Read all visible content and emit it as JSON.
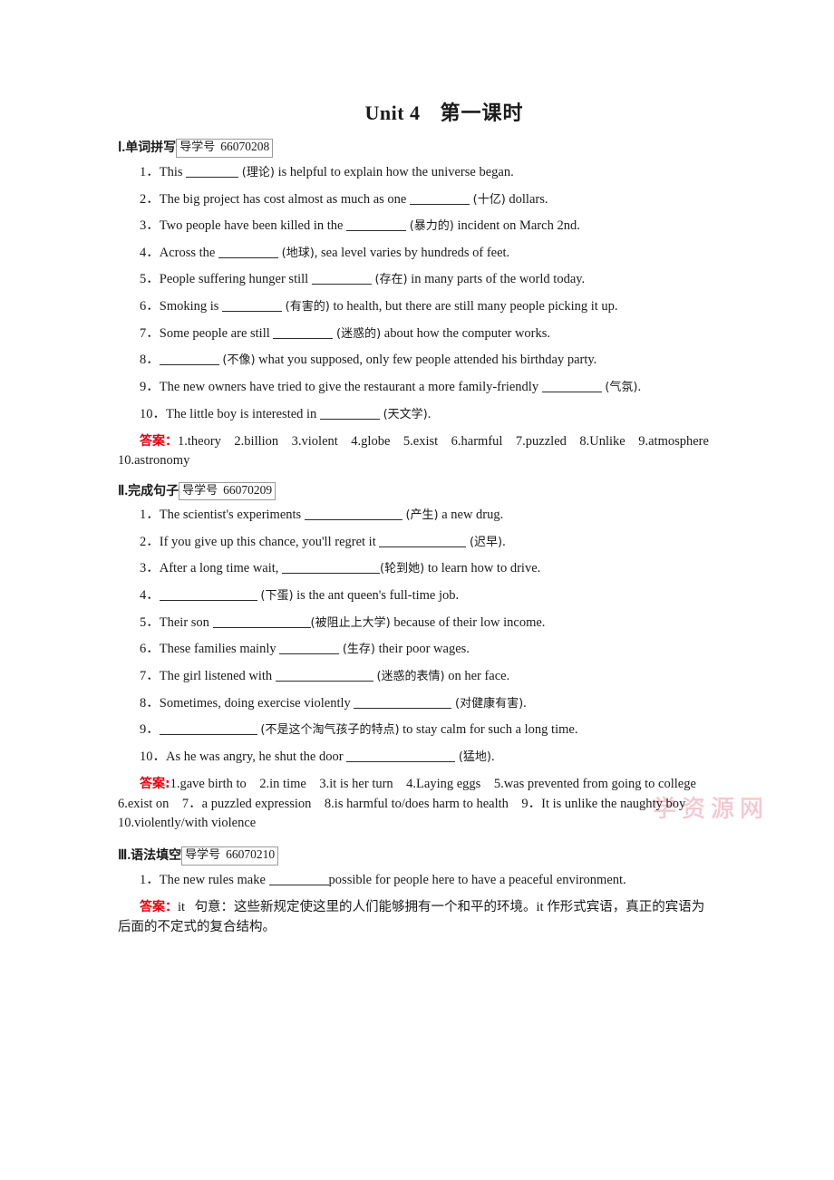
{
  "document": {
    "title_unit": "Unit 4",
    "title_cn": "第一课时",
    "watermark": "学资源网"
  },
  "sections": [
    {
      "numeral": "Ⅰ.",
      "name": "单词拼写",
      "badge_label": "导学号",
      "badge_number": "66070208",
      "questions": [
        {
          "num": "1．",
          "pre": "This ",
          "hint": "(理论)",
          "post": " is helpful to explain how the universe began.",
          "blank": "b-sm"
        },
        {
          "num": "2．",
          "pre": "The big project has cost almost as much as one ",
          "hint": "(十亿)",
          "post": " dollars.",
          "blank": "b-md"
        },
        {
          "num": "3．",
          "pre": "Two people have been killed in the ",
          "hint": "(暴力的)",
          "post": " incident on March 2nd.",
          "blank": "b-md"
        },
        {
          "num": "4．",
          "pre": "Across the ",
          "hint": "(地球)",
          "post": ", sea level varies by hundreds of feet.",
          "blank": "b-md"
        },
        {
          "num": "5．",
          "pre": "People suffering hunger still ",
          "hint": "(存在)",
          "post": " in many parts of the world today.",
          "blank": "b-md"
        },
        {
          "num": "6．",
          "pre": "Smoking is ",
          "hint": "(有害的)",
          "post": " to health, but there are still many people picking it up.",
          "blank": "b-md"
        },
        {
          "num": "7．",
          "pre": "Some people are still ",
          "hint": "(迷惑的)",
          "post": " about how the computer works.",
          "blank": "b-md"
        },
        {
          "num": "8．",
          "pre": "",
          "hint": "(不像)",
          "post": " what you supposed, only few people attended his birthday party.",
          "blank": "b-md"
        },
        {
          "num": "9．",
          "pre": "The new owners have tried to give the restaurant a more family-friendly ",
          "hint": "(气氛)",
          "post": ".",
          "blank": "b-md"
        },
        {
          "num": "10．",
          "pre": "The little boy is interested in ",
          "hint": "(天文学)",
          "post": ".",
          "blank": "b-md"
        }
      ],
      "answer_label": "答案：",
      "answer_text": "1.theory　2.billion　3.violent　4.globe　5.exist　6.harmful　7.puzzled　8.Unlike　9.atmosphere　10.astronomy"
    },
    {
      "numeral": "Ⅱ.",
      "name": "完成句子",
      "badge_label": "导学号",
      "badge_number": "66070209",
      "questions": [
        {
          "num": "1．",
          "pre": "The scientist's experiments ",
          "hint": "(产生)",
          "post": " a new drug.",
          "blank": "b-xl"
        },
        {
          "num": "2．",
          "pre": "If you give up this chance, you'll regret it ",
          "hint": "(迟早)",
          "post": ".",
          "blank": "b-lg"
        },
        {
          "num": "3．",
          "pre": "After a long time wait, ",
          "hint": "(轮到她)",
          "post": " to learn how to drive.",
          "blank": "b-xl"
        },
        {
          "num": "4．",
          "pre": "",
          "hint": "(下蛋)",
          "post": " is the ant queen's full-time job.",
          "blank": "b-xl"
        },
        {
          "num": "5．",
          "pre": "Their son ",
          "hint": "(被阻止上大学)",
          "post": " because of their low income.",
          "blank": "b-xl"
        },
        {
          "num": "6．",
          "pre": "These families mainly ",
          "hint": "(生存)",
          "post": " their poor wages.",
          "blank": "b-md"
        },
        {
          "num": "7．",
          "pre": "The girl listened with ",
          "hint": "(迷惑的表情)",
          "post": " on her face.",
          "blank": "b-xl"
        },
        {
          "num": "8．",
          "pre": "Sometimes, doing exercise violently ",
          "hint": "(对健康有害)",
          "post": ".",
          "blank": "b-xl"
        },
        {
          "num": "9．",
          "pre": "",
          "hint": "(不是这个淘气孩子的特点)",
          "post": " to stay calm for such a long time.",
          "blank": "b-xl"
        },
        {
          "num": "10．",
          "pre": "As he was angry, he shut the door ",
          "hint": "(猛地)",
          "post": ".",
          "blank": "b-xxl"
        }
      ],
      "answer_label": "答案:",
      "answer_text": "1.gave birth to　2.in time　3.it is her turn　4.Laying eggs　5.was prevented from going to college　6.exist on　7．a puzzled expression　8.is harmful to/does harm to health　9．It is unlike the naughty boy　10.violently/with violence"
    },
    {
      "numeral": "Ⅲ.",
      "name": "语法填空",
      "badge_label": "导学号",
      "badge_number": "66070210",
      "questions": [
        {
          "num": "1．",
          "pre": "The new rules make ",
          "hint": "",
          "post": "possible for people here to have a peaceful environment.",
          "blank": "b-md"
        }
      ],
      "answer_label": "答案：",
      "answer_text_en": "it",
      "answer_text": "句意：这些新规定使这里的人们能够拥有一个和平的环境。it 作形式宾语，真正的宾语为后面的不定式的复合结构。"
    }
  ]
}
